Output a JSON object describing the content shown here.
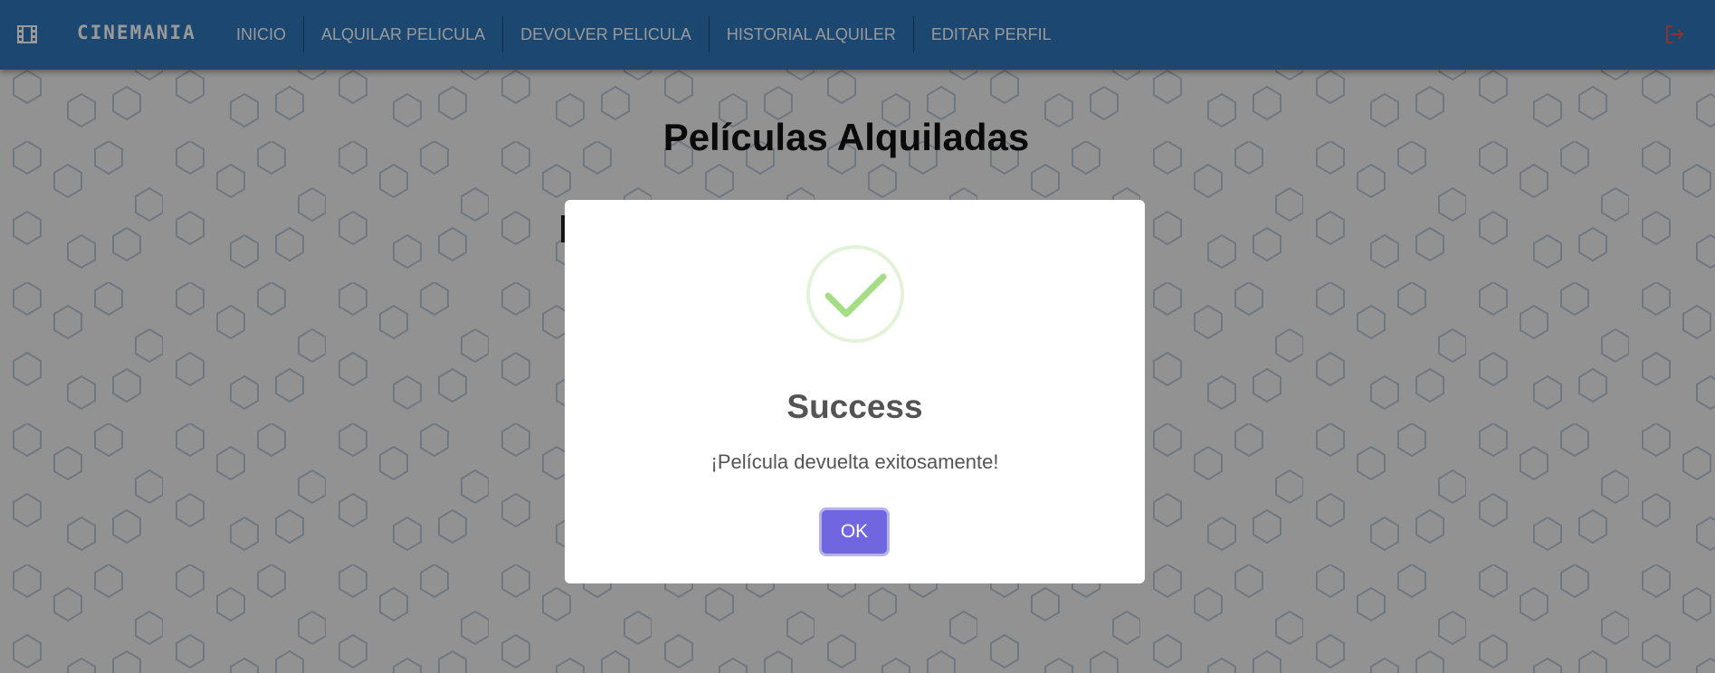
{
  "colors": {
    "navbar": "#2d77bb",
    "primary_button": "#7066e0",
    "success": "#a5dc86",
    "logout": "#e05a4f"
  },
  "nav": {
    "brand": "CINEMANIA",
    "logo_icon": "film-icon",
    "items": [
      {
        "label": "INICIO"
      },
      {
        "label": "ALQUILAR PELICULA"
      },
      {
        "label": "DEVOLVER PELICULA"
      },
      {
        "label": "HISTORIAL ALQUILER"
      },
      {
        "label": "EDITAR PERFIL"
      }
    ],
    "logout_icon": "logout-icon"
  },
  "page": {
    "title": "Películas Alquiladas"
  },
  "dialog": {
    "icon": "success-check-icon",
    "title": "Success",
    "message": "¡Película devuelta exitosamente!",
    "ok_label": "OK"
  }
}
